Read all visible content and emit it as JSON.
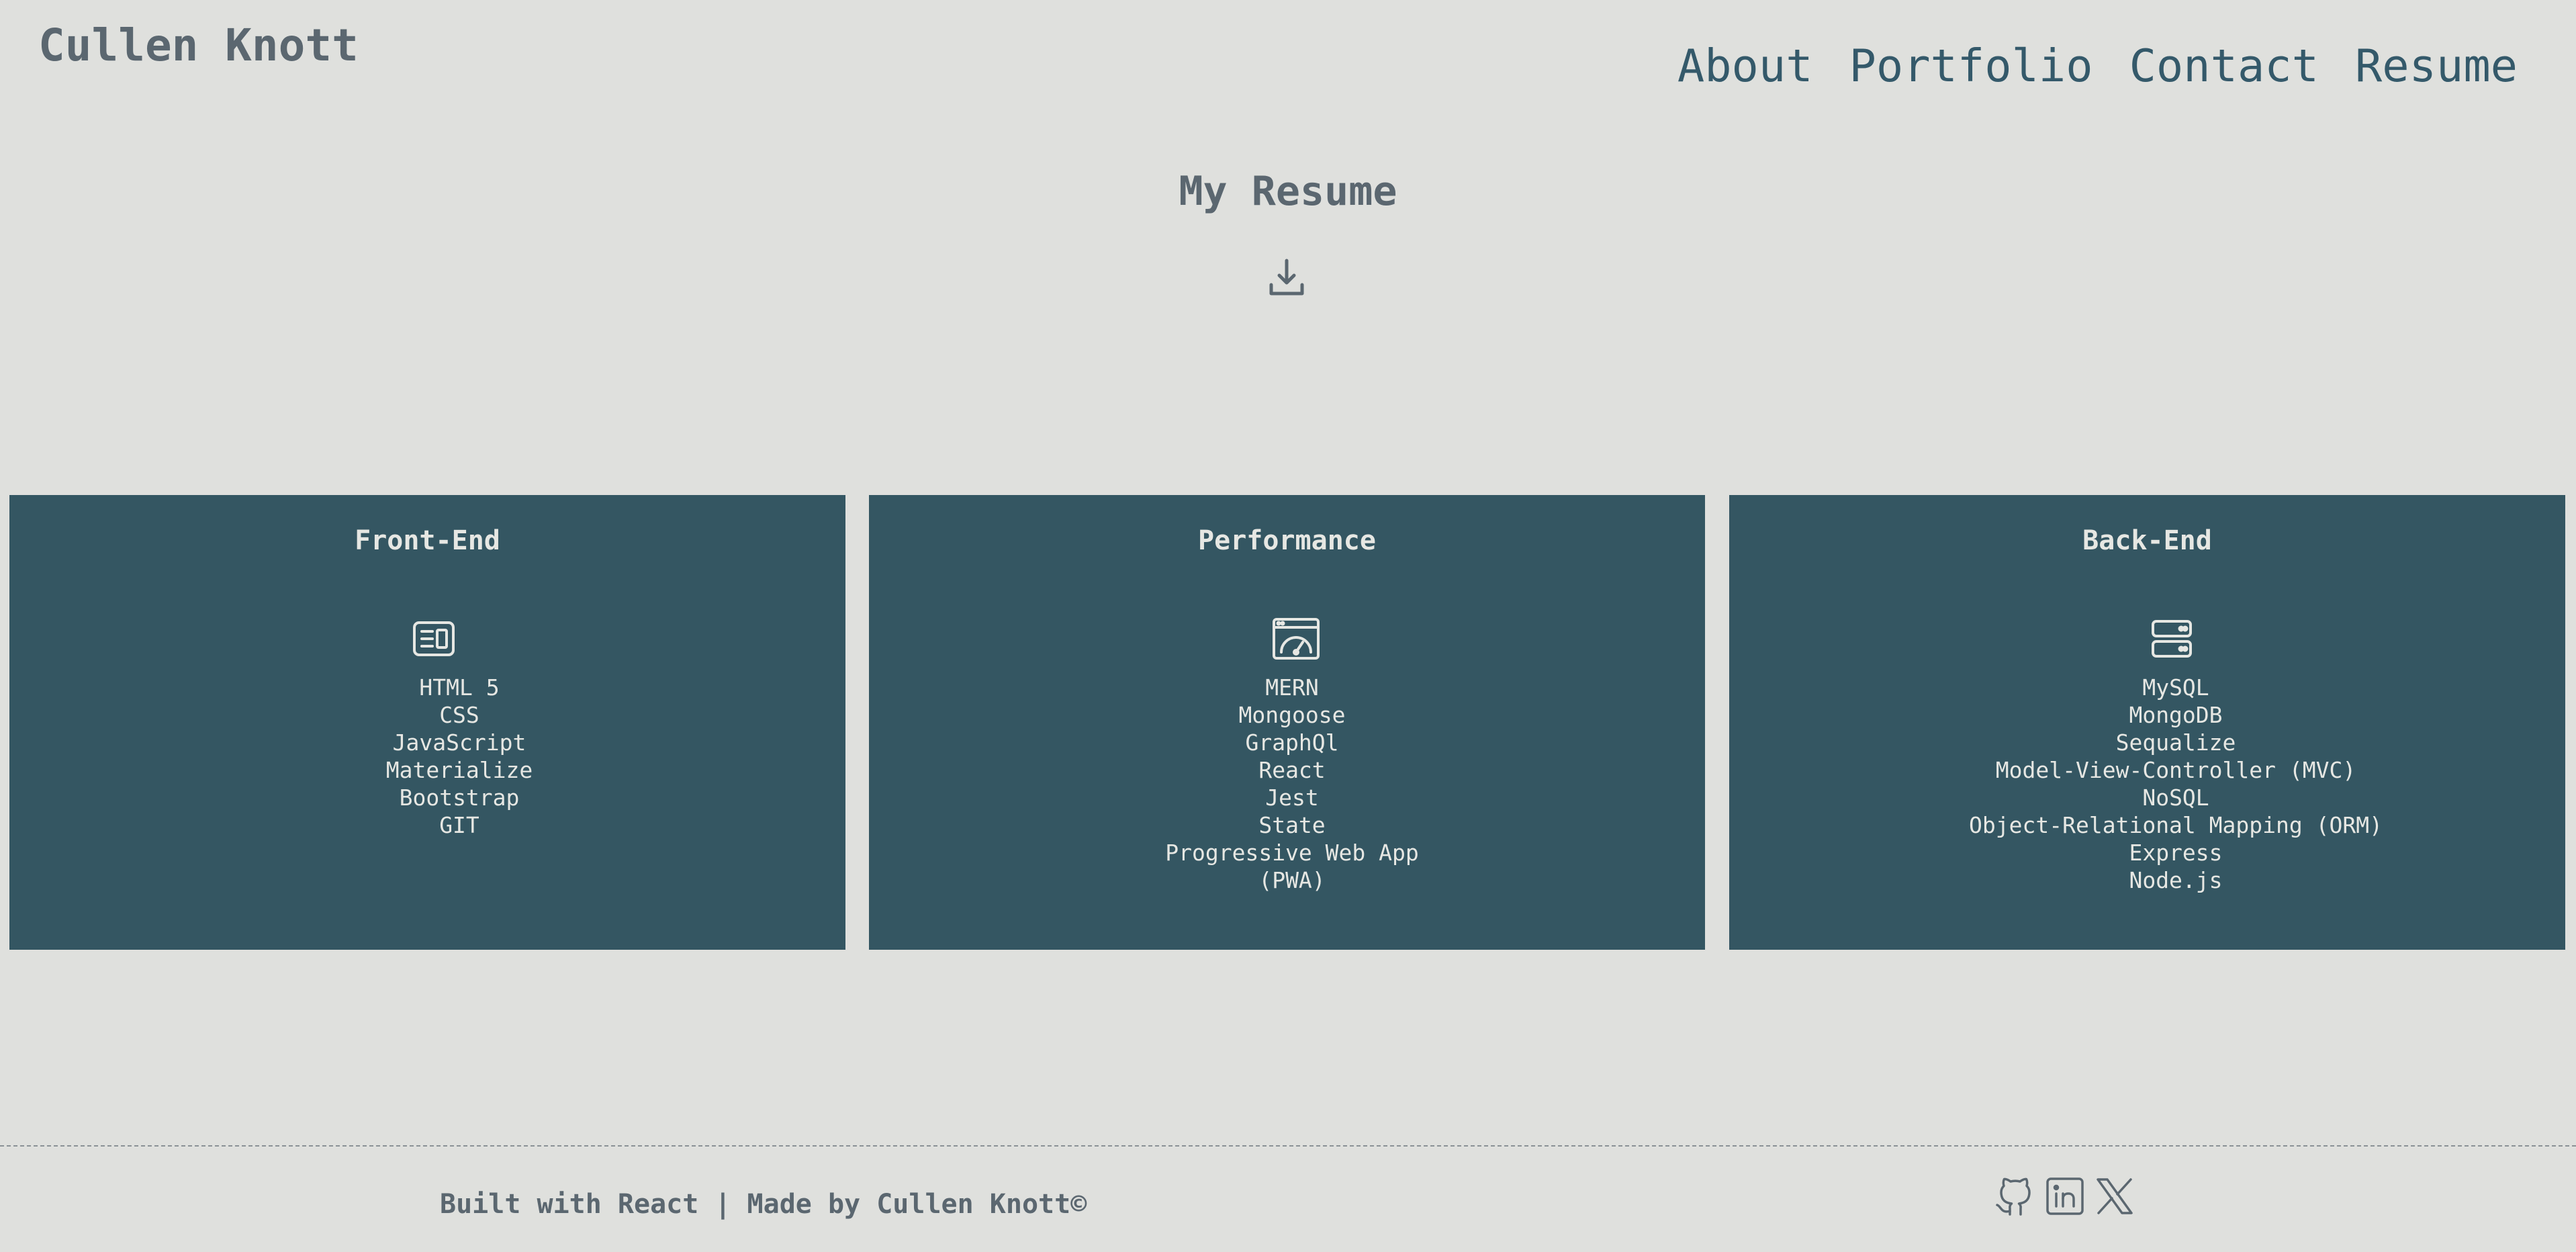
{
  "header": {
    "brand": "Cullen Knott",
    "nav": [
      "About",
      "Portfolio",
      "Contact",
      "Resume"
    ]
  },
  "main": {
    "title": "My Resume",
    "download_icon": "download-icon",
    "cards": [
      {
        "title": "Front-End",
        "icon": "browser-layout-icon",
        "items": [
          "HTML 5",
          "CSS",
          "JavaScript",
          "Materialize",
          "Bootstrap",
          "GIT"
        ]
      },
      {
        "title": "Performance",
        "icon": "speedometer-icon",
        "items": [
          "MERN",
          "Mongoose",
          "GraphQl",
          "React",
          "Jest",
          "State",
          "Progressive Web App (PWA)"
        ]
      },
      {
        "title": "Back-End",
        "icon": "server-icon",
        "items": [
          "MySQL",
          "MongoDB",
          "Sequalize",
          "Model-View-Controller (MVC)",
          "NoSQL",
          "Object-Relational Mapping (ORM)",
          "Express",
          "Node.js"
        ]
      }
    ]
  },
  "footer": {
    "text": "Built with React | Made by Cullen Knott©",
    "social": [
      "github-icon",
      "linkedin-icon",
      "x-twitter-icon"
    ]
  },
  "colors": {
    "background": "#dfe0dd",
    "card": "#345662",
    "nav": "#34596a",
    "muted_text": "#5b6770",
    "card_text": "#e6e7e3"
  }
}
